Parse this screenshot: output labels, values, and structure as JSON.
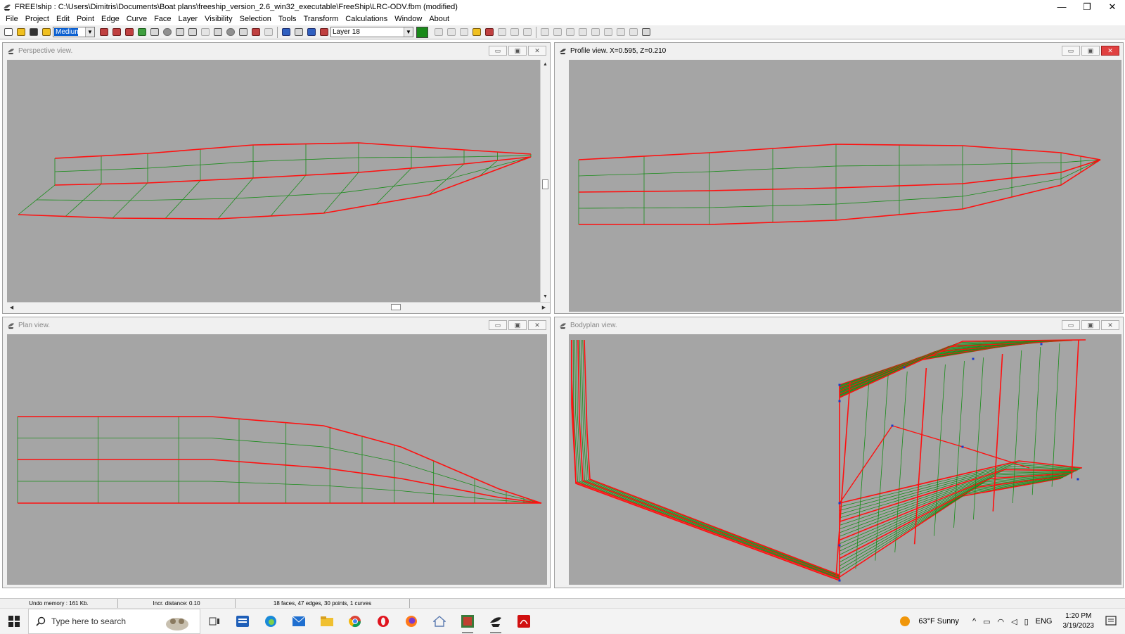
{
  "window": {
    "title": "FREE!ship   : C:\\Users\\Dimitris\\Documents\\Boat plans\\freeship_version_2.6_win32_executable\\FreeShip\\LRC-ODV.fbm (modified)",
    "min_glyph": "—",
    "max_glyph": "❐",
    "close_glyph": "✕"
  },
  "menu": [
    "File",
    "Project",
    "Edit",
    "Point",
    "Edge",
    "Curve",
    "Face",
    "Layer",
    "Visibility",
    "Selection",
    "Tools",
    "Transform",
    "Calculations",
    "Window",
    "About"
  ],
  "toolbar": {
    "zoom_value": "Medium",
    "layer_value": "Layer 18",
    "layer_color": "#1a8a1a"
  },
  "views": {
    "perspective": {
      "title": "Perspective view."
    },
    "profile": {
      "title": "Profile view.  X=0.595,  Z=0.210"
    },
    "plan": {
      "title": "Plan view."
    },
    "bodyplan": {
      "title": "Bodyplan view."
    }
  },
  "view_buttons": {
    "min": "▭",
    "max": "▣",
    "close": "✕"
  },
  "colors": {
    "edge": "#ff1010",
    "grid": "#1a8c1a",
    "point": "#1a3acc",
    "background": "#a5a5a5"
  },
  "status": {
    "undo": "Undo memory : 161 Kb.",
    "incr": "Incr. distance: 0.10",
    "info": "18 faces, 47 edges, 30 points, 1 curves"
  },
  "taskbar": {
    "search_placeholder": "Type here to search",
    "weather": "63°F  Sunny",
    "lang": "ENG",
    "time": "1:20 PM",
    "date": "3/19/2023"
  }
}
